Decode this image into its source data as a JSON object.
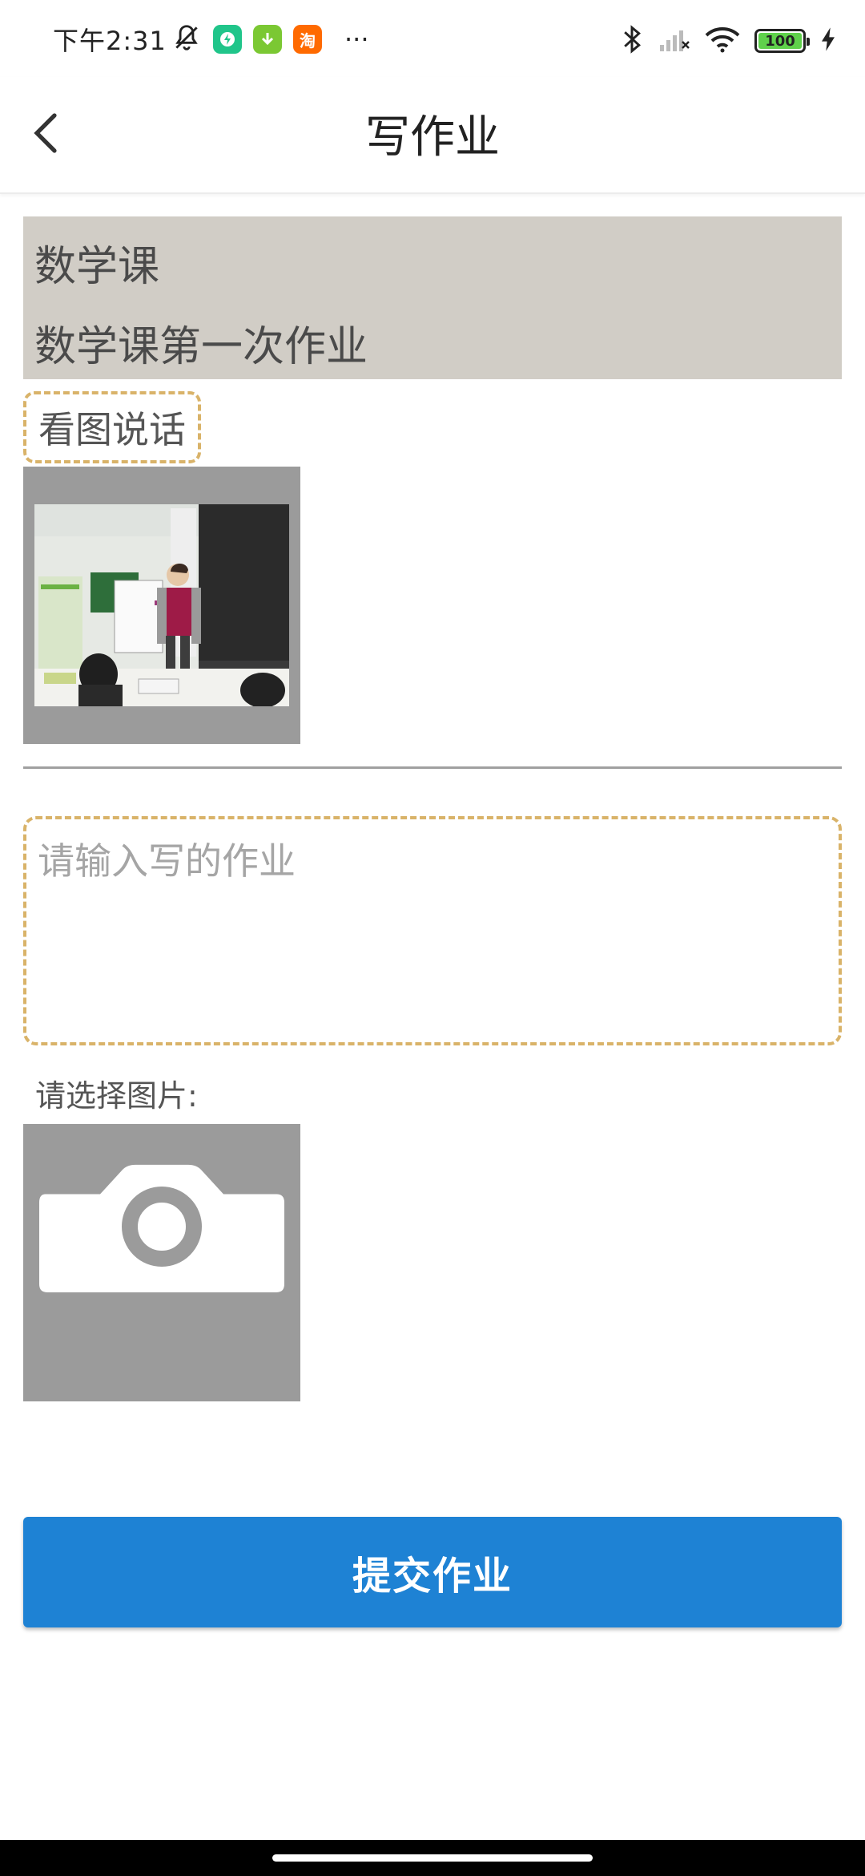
{
  "status_bar": {
    "time": "下午2:31",
    "battery_level": "100",
    "battery_fraction": 1.0,
    "app_badges": [
      {
        "icon": "lightning-app-icon",
        "color": "#20c58a"
      },
      {
        "icon": "download-app-icon",
        "color": "#7bc833"
      },
      {
        "icon": "taobao-app-icon",
        "color": "#ff6a00",
        "text": "淘"
      }
    ],
    "more": "···"
  },
  "header": {
    "title": "写作业",
    "back_icon": "chevron-left-icon"
  },
  "course": {
    "name": "数学课",
    "homework_title": "数学课第一次作业"
  },
  "topic": {
    "tag": "看图说话"
  },
  "answer": {
    "placeholder": "请输入写的作业",
    "value": ""
  },
  "image_picker": {
    "label": "请选择图片:",
    "icon": "camera-icon"
  },
  "submit": {
    "label": "提交作业"
  },
  "colors": {
    "accent": "#1e82d4",
    "card_bg": "#d1cdc6",
    "dashed_border": "#d9b369",
    "photo_frame": "#9b9b9b"
  }
}
